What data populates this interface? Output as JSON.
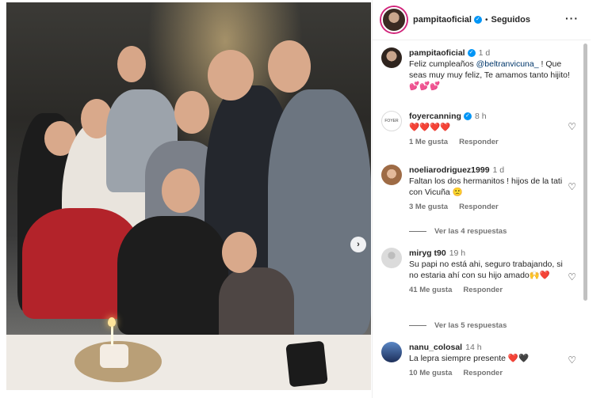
{
  "post": {
    "next_icon": "chevron-right-icon"
  },
  "header": {
    "username": "pampitaoficial",
    "separator": "•",
    "follow_status": "Seguidos",
    "more": "···"
  },
  "caption": {
    "username": "pampitaoficial",
    "time": "1 d",
    "text_before": "Feliz cumpleaños ",
    "mention": "@beltranvicuna_",
    "text_after": " ! Que seas muy muy feliz, Te amamos tanto hijito! 💕💕💕"
  },
  "comments": [
    {
      "username": "foyercanning",
      "time": "8 h",
      "text": "❤️❤️❤️❤️",
      "likes": "1 Me gusta",
      "reply": "Responder",
      "avatar_text": "FOYER"
    },
    {
      "username": "noeliarodriguez1999",
      "time": "1 d",
      "text": "Faltan los dos hermanitos ! hijos de la tati con Vicuña 🙁",
      "likes": "3 Me gusta",
      "reply": "Responder",
      "view_replies": "Ver las 4 respuestas"
    },
    {
      "username": "miryg t90",
      "time": "19 h",
      "text": "Su papi no está ahi, seguro trabajando, si no estaria ahí con su hijo amado🙌❤️",
      "likes": "41 Me gusta",
      "reply": "Responder",
      "view_replies": "Ver las 5 respuestas"
    },
    {
      "username": "nanu_colosal",
      "time": "14 h",
      "text": "La lepra siempre presente ❤️🖤",
      "likes": "10 Me gusta",
      "reply": "Responder"
    }
  ],
  "icons": {
    "heart": "♡",
    "verified": "✓",
    "arrow": "›"
  },
  "colors": {
    "verified": "#0095f6",
    "link": "#00376b",
    "muted": "#737373"
  }
}
